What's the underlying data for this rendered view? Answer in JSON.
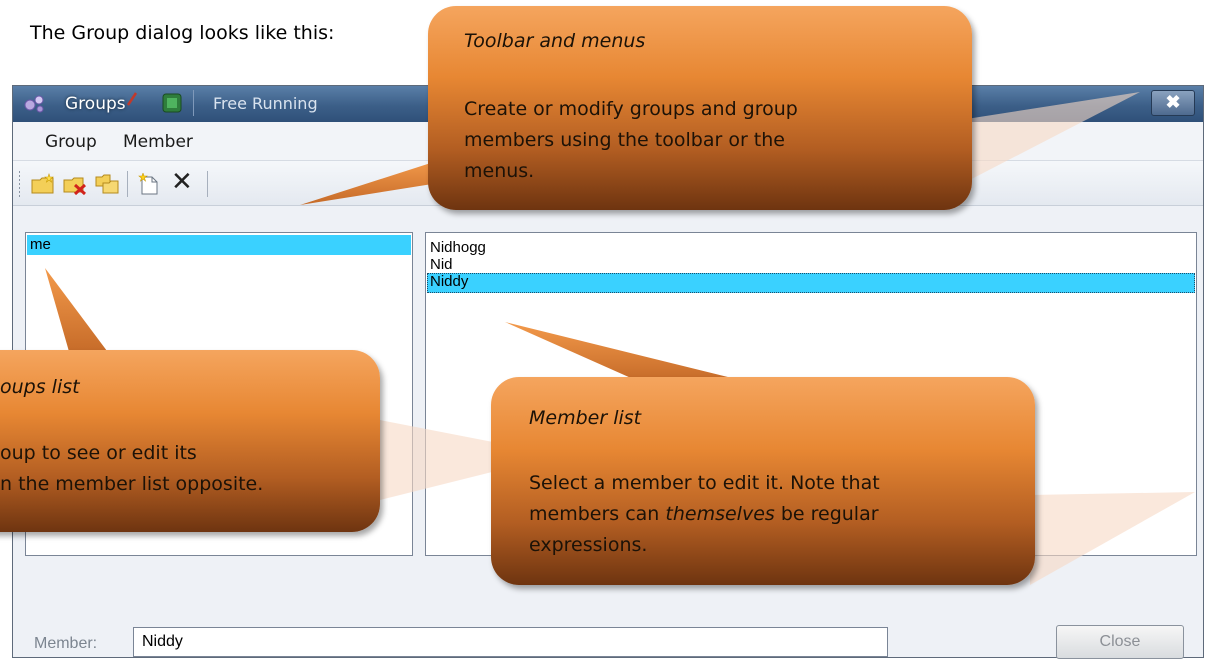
{
  "intro_text": "The Group dialog looks like this:",
  "window": {
    "title": "Groups",
    "mode_text": "Free Running",
    "close_glyph": "✖"
  },
  "menu": {
    "items": [
      "Group",
      "Member"
    ]
  },
  "toolbar": {
    "icons": [
      "new-group-icon",
      "delete-group-icon",
      "copy-group-icon",
      "new-member-icon",
      "delete-member-icon"
    ],
    "delete_glyph": "✕"
  },
  "groups_list": {
    "items": [
      "me"
    ],
    "selected_index": 0
  },
  "members_list": {
    "items": [
      "Nidhogg",
      "Nid",
      "Niddy"
    ],
    "selected_index": 2
  },
  "bottom": {
    "member_label": "Member:",
    "member_value": "Niddy",
    "close_label": "Close"
  },
  "callouts": {
    "toolbar": {
      "title": "Toolbar and menus",
      "body_line1": "Create or modify groups and group",
      "body_line2": "members using the toolbar or the",
      "body_line3": "menus."
    },
    "groups": {
      "title": "oups list",
      "body_line1": "oup to see or edit its",
      "body_line2": "n the member list opposite."
    },
    "members": {
      "title": "Member list",
      "body_line1": "Select a member to edit it. Note that",
      "body_line2_pre": "members can ",
      "body_line2_em": "themselves",
      "body_line2_post": " be regular",
      "body_line3": "expressions."
    }
  },
  "colors": {
    "selection": "#3ad1ff",
    "callout_top": "#f5a55e",
    "callout_bottom": "#6e3410",
    "titlebar": "#3c5f88"
  }
}
